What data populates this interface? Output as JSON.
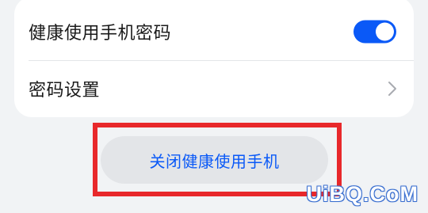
{
  "settings": {
    "health_password_label": "健康使用手机密码",
    "health_password_enabled": true,
    "password_settings_label": "密码设置"
  },
  "actions": {
    "close_label": "关闭健康使用手机"
  },
  "watermark": {
    "text": "UiBQ.CoM"
  },
  "colors": {
    "accent": "#0a59f7",
    "highlight": "#e8282b",
    "background": "#f1f3f5",
    "card": "#ffffff",
    "button_bg": "#e3e5e8"
  },
  "icons": {
    "toggle": "toggle-switch-icon",
    "chevron": "chevron-right-icon"
  }
}
